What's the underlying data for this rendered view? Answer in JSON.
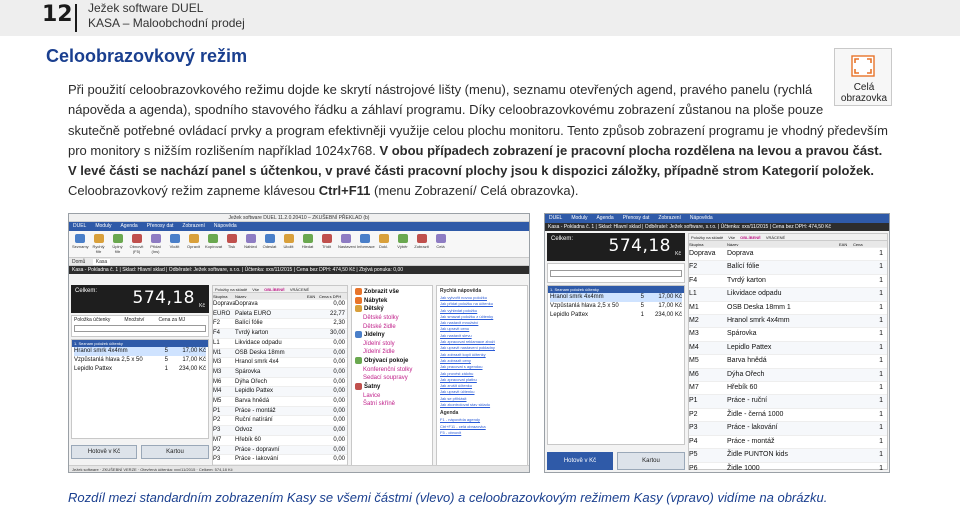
{
  "header": {
    "page_number": "12",
    "product": "Ježek software DUEL",
    "module": "KASA – Maloobchodní prodej"
  },
  "section_title": "Celoobrazovkový režim",
  "paragraph": {
    "line1": "Při použití celoobrazovkového režimu dojde ke skrytí nástrojové lišty (menu), seznamu otevřených agend, pravého panelu (rychlá",
    "line2": "nápověda a agenda), spodního stavového řádku a záhlaví programu. Díky celoobrazovkovému zobrazení zůstanou na ploše pouze",
    "line3": "skutečně potřebné ovládací prvky a program efektivněji využije celou plochu monitoru.",
    "line4": "Tento způsob zobrazení programu je vhodný především",
    "line5a": "pro monitory s nižším rozlišením například 1024x768.",
    "line5b": "V obou případech zobrazení je pracovní plocha rozdělena na levou a pravou část.",
    "line6": "V levé části se nachází panel s účtenkou, v pravé části pracovní plochy jsou k dispozici záložky, případně strom Kategorií položek.",
    "line7a": "Celoobrazovkový režim zapneme klávesou",
    "line7b": "Ctrl+F11",
    "line7c": "(menu Zobrazení/ Celá obrazovka)."
  },
  "fullscreen_icon": {
    "label1": "Celá",
    "label2": "obrazovka",
    "icon": "fullscreen-icon"
  },
  "shot_left": {
    "window_title": "Ježek software DUEL 11.2.0.20410 – ZKUŠEBNÍ PŘEKLAD (b)",
    "menu": [
      "DUEL",
      "Moduly",
      "Agenda",
      "Přenosy dat",
      "Zobrazení",
      "Nápověda"
    ],
    "toolbar": [
      "Seznamy",
      "Rychlý filtr",
      "Úplný filtr",
      "Obnovit (F5)",
      "Přidat (Ins)",
      "Vložit",
      "Opravit",
      "Kopírovat",
      "Tisk",
      "Náhled",
      "Odeslat",
      "Uložit",
      "Hledat",
      "Třídit",
      "Nastavení",
      "Informace",
      "Dokl.",
      "Výběr",
      "Zobrazit",
      "Celá"
    ],
    "tabs": [
      "Domů",
      "Kasa"
    ],
    "info": "Kasa - Pokladna č. 1 | Sklad: Hlavní sklad | Odběratel: Ježek software, s.r.o. | Účtenka: xxx/11/2015 | Cena bez DPH: 474,50 Kč | Zbývá ponuka: 0,00",
    "celkem_label": "Celkem:",
    "celkem_value": "574,18",
    "celkem_unit": "Kč",
    "doplnek": [
      "Položka účtenky",
      "Množství",
      "Cena za MJ"
    ],
    "receipt_tab": "1. Seznam položek účtenky",
    "receipt_rows": [
      {
        "name": "Hranol smrk 4x4mm",
        "qty": "5",
        "price": "17,00 Kč"
      },
      {
        "name": "Vzpůstanlá hlava 2,5 x 50",
        "qty": "5",
        "price": "17,00 Kč"
      },
      {
        "name": "Lepidlo Pattex",
        "qty": "1",
        "price": "234,00 Kč"
      }
    ],
    "hotove": "Hotově v Kč",
    "kartou": "Kartou",
    "filter_tabs": [
      "Položky na skladě",
      "Vše",
      "OBLÍBENÉ",
      "VRÁCENÉ"
    ],
    "grid_headers": [
      "Skupina",
      "Název",
      "EAN",
      "Cena s DPH"
    ],
    "grid_rows": [
      [
        "Doprava",
        "Doprava",
        "",
        "0,00"
      ],
      [
        "EURO",
        "Paleta EURO",
        "",
        "22,77"
      ],
      [
        "F2",
        "Balící fólie",
        "",
        "2,30"
      ],
      [
        "F4",
        "Tvrdý karton",
        "",
        "30,00"
      ],
      [
        "L1",
        "Likvidace odpadu",
        "",
        "0,00"
      ],
      [
        "M1",
        "OSB Deska 18mm",
        "",
        "0,00"
      ],
      [
        "M3",
        "Hranol smrk 4x4",
        "",
        "0,00"
      ],
      [
        "M3",
        "Spárovka",
        "",
        "0,00"
      ],
      [
        "M6",
        "Dýha Ořech",
        "",
        "0,00"
      ],
      [
        "M4",
        "Lepidlo Pattex",
        "",
        "0,00"
      ],
      [
        "M5",
        "Barva hnědá",
        "",
        "0,00"
      ],
      [
        "P1",
        "Práce - montáž",
        "",
        "0,00"
      ],
      [
        "P2",
        "Ruční natírání",
        "",
        "0,00"
      ],
      [
        "P3",
        "Odvoz",
        "",
        "0,00"
      ],
      [
        "M7",
        "Hřebík 60",
        "",
        "0,00"
      ],
      [
        "P2",
        "Práce - dopravní",
        "",
        "0,00"
      ],
      [
        "P3",
        "Práce - lakování",
        "",
        "0,00"
      ],
      [
        "P4",
        "Práce - montáž",
        "",
        "0,00"
      ]
    ],
    "tree_label": "Zobrazit vše",
    "tree": [
      {
        "h": "Nábytek",
        "items": []
      },
      {
        "h": "Dětský",
        "items": [
          "Dětské stolky",
          "Dětské židle"
        ]
      },
      {
        "h": "Jídelny",
        "items": [
          "Jídelní stoly",
          "Jídelní židle"
        ]
      },
      {
        "h": "Obývací pokoje",
        "items": [
          "Konferenční stolky",
          "Sedací soupravy"
        ]
      },
      {
        "h": "Šatny",
        "items": [
          "Lavice",
          "Šatní skříně"
        ]
      }
    ],
    "help_title": "Rychlá nápověda",
    "help_links": [
      "Jak vytvořit novou položku",
      "Jak přidat položku na účtenku",
      "Jak vyhledat položku",
      "Jak smazat položku z účtenky",
      "Jak nastavit množství",
      "Jak upravit cenu",
      "Jak nastavit slevu",
      "Jak zpracovat reklamace zboží",
      "Jak upravit nastavení pokladny",
      "Jak zobrazit kopii účtenky",
      "Jak zobrazit ceny",
      "Jak pracovat s agendou",
      "Jak provést zálohu",
      "Jak zpracovat platbu",
      "Jak zrušit účtenku",
      "Jak upravit účtenku",
      "Jak se přihlásit",
      "Jak zkontrolovat stav skladu"
    ],
    "agenda_title": "Agenda",
    "agenda_links": [
      "F1 - nápověda agendy",
      "Ctrl+F11 - celá obrazovka",
      "F5 - obnovit"
    ],
    "status": "Ježek software · ZKUŠEBNÍ VERZE · Otevřená účtenka: xxx/11/2015 · Celkem: 574,18 Kč"
  },
  "shot_right": {
    "menu": [
      "DUEL",
      "Moduly",
      "Agenda",
      "Přenosy dat",
      "Zobrazení",
      "Nápověda"
    ],
    "info": "Kasa - Pokladna č. 1 | Sklad: Hlavní sklad | Odběratel: Ježek software, s.r.o. | Účtenka: xxx/11/2015 | Cena bez DPH: 474,50 Kč",
    "celkem_label": "Celkem:",
    "celkem_value": "574,18",
    "celkem_unit": "Kč",
    "receipt_tab": "1. Seznam položek účtenky",
    "receipt_rows": [
      {
        "name": "Hranol smrk 4x4mm",
        "qty": "5",
        "price": "17,00 Kč"
      },
      {
        "name": "Vzpůstanlá hlava 2,5 x 50",
        "qty": "5",
        "price": "17,00 Kč"
      },
      {
        "name": "Lepidlo Pattex",
        "qty": "1",
        "price": "234,00 Kč"
      }
    ],
    "hotove": "Hotově v Kč",
    "kartou": "Kartou",
    "filter_tabs": [
      "Položky na skladě",
      "Vše",
      "OBLÍBENÉ",
      "VRÁCENÉ"
    ],
    "grid_headers": [
      "Skupina",
      "Název",
      "EAN",
      "Cena"
    ],
    "grid_rows": [
      [
        "Doprava",
        "Doprava",
        "",
        "1"
      ],
      [
        "F2",
        "Balící fólie",
        "",
        "1"
      ],
      [
        "F4",
        "Tvrdý karton",
        "",
        "1"
      ],
      [
        "L1",
        "Likvidace odpadu",
        "",
        "1"
      ],
      [
        "M1",
        "OSB Deska 18mm 1",
        "",
        "1"
      ],
      [
        "M2",
        "Hranol smrk 4x4mm",
        "",
        "1"
      ],
      [
        "M3",
        "Spárovka",
        "",
        "1"
      ],
      [
        "M4",
        "Lepidlo Pattex",
        "",
        "1"
      ],
      [
        "M5",
        "Barva hnědá",
        "",
        "1"
      ],
      [
        "M6",
        "Dýha Ořech",
        "",
        "1"
      ],
      [
        "M7",
        "Hřebík 60",
        "",
        "1"
      ],
      [
        "P1",
        "Práce - ruční",
        "",
        "1"
      ],
      [
        "P2",
        "Židle - černá 1000",
        "",
        "1"
      ],
      [
        "P3",
        "Práce - lakování",
        "",
        "1"
      ],
      [
        "P4",
        "Práce - montáž",
        "",
        "1"
      ],
      [
        "P5",
        "Židle PUNTON kids",
        "",
        "1"
      ],
      [
        "P6",
        "Židle 1000",
        "",
        "1"
      ]
    ]
  },
  "caption": "Rozdíl mezi standardním zobrazením Kasy se všemi částmi (vlevo) a celoobrazovkovým režimem Kasy (vpravo) vidíme na obrázku.",
  "colors": {
    "accent": "#1a3f8f",
    "menubar": "#2f5aa8",
    "total_bg": "#1e1e1e",
    "tree_item": "#c0208a",
    "link": "#2a5bd7"
  }
}
